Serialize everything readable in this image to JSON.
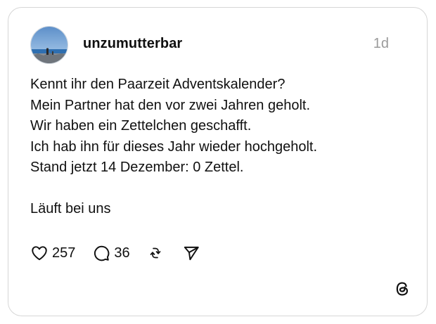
{
  "post": {
    "username": "unzumutterbar",
    "timestamp": "1d",
    "lines": [
      "Kennt ihr den Paarzeit Adventskalender?",
      "Mein Partner hat den vor zwei Jahren geholt.",
      "Wir haben ein Zettelchen geschafft.",
      "Ich hab ihn für dieses Jahr wieder hochgeholt.",
      "Stand jetzt 14 Dezember: 0 Zettel.",
      "Läuft bei uns"
    ]
  },
  "actions": {
    "likes": "257",
    "replies": "36"
  },
  "icons": {
    "like": "heart-icon",
    "reply": "comment-bubble-icon",
    "repost": "repost-icon",
    "share": "send-icon",
    "brand": "threads-logo-icon"
  },
  "colors": {
    "text": "#101010",
    "muted": "#9a9a9a",
    "border": "#d6d6d6"
  }
}
